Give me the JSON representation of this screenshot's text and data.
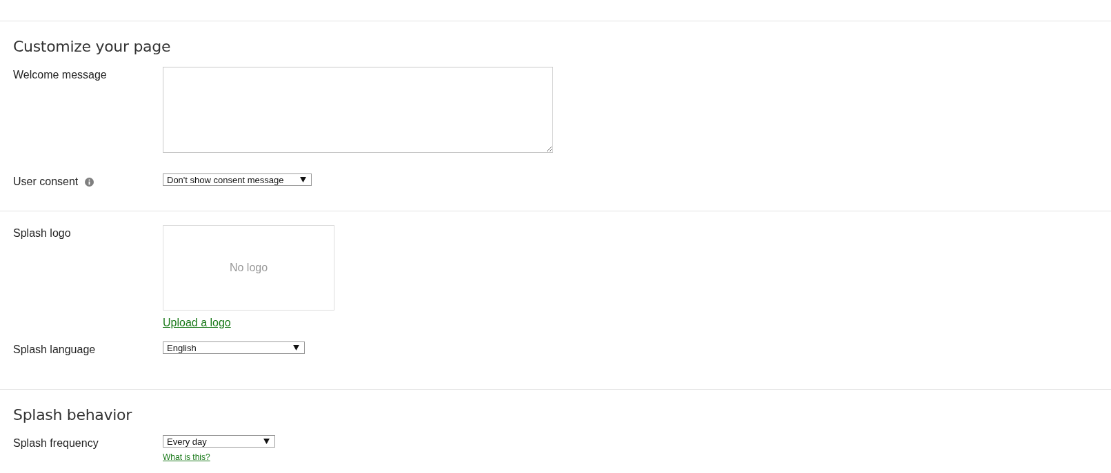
{
  "sections": [
    {
      "title": "Customize your page",
      "fields": [
        {
          "kind": "textarea",
          "label": "Welcome message"
        },
        {
          "kind": "select",
          "label": "User consent",
          "info": true,
          "value": "Don't show consent message"
        }
      ]
    },
    {
      "fields": [
        {
          "kind": "logo",
          "label": "Splash logo",
          "empty_text": "No logo",
          "link": "Upload a logo"
        },
        {
          "kind": "select",
          "label": "Splash language",
          "value": "English"
        }
      ]
    },
    {
      "title": "Splash behavior",
      "fields": [
        {
          "kind": "select",
          "label": "Splash frequency",
          "value": "Every day",
          "link": "What is this?"
        }
      ]
    }
  ]
}
